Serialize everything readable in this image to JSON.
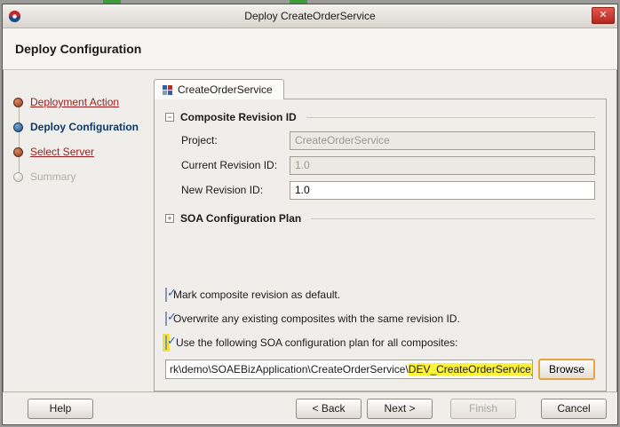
{
  "window": {
    "title": "Deploy CreateOrderService",
    "header": "Deploy Configuration",
    "close_label": "✕"
  },
  "sidebar": {
    "steps": [
      {
        "label": "Deployment Action",
        "state": "link"
      },
      {
        "label": "Deploy Configuration",
        "state": "current"
      },
      {
        "label": "Select Server",
        "state": "link"
      },
      {
        "label": "Summary",
        "state": "disabled"
      }
    ]
  },
  "main": {
    "tab_label": "CreateOrderService",
    "revision_section": {
      "title": "Composite Revision ID",
      "collapse_glyph": "−",
      "fields": [
        {
          "label": "Project:",
          "value": "CreateOrderService",
          "disabled": true
        },
        {
          "label": "Current Revision ID:",
          "value": "1.0",
          "disabled": true
        },
        {
          "label": "New Revision ID:",
          "value": "1.0",
          "disabled": false
        }
      ]
    },
    "configplan_section": {
      "title": "SOA Configuration Plan",
      "expand_glyph": "+"
    },
    "checkboxes": [
      {
        "label": "Mark composite revision as default.",
        "checked": true,
        "tick": "✓"
      },
      {
        "label": "Overwrite any existing composites with the same revision ID.",
        "checked": true,
        "tick": "✓"
      },
      {
        "label": "Use the following SOA configuration plan for all composites:",
        "checked": true,
        "tick": "✓",
        "highlighted": true
      }
    ],
    "path_field": {
      "visible_prefix": "rk\\demo\\SOAEBizApplication\\CreateOrderService\\",
      "highlighted_part": "DEV_CreateOrderService_cfgplan.xml"
    },
    "browse_label": "Browse"
  },
  "footer": {
    "help": "Help",
    "back": "< Back",
    "next": "Next >",
    "finish": "Finish",
    "cancel": "Cancel"
  },
  "colors": {
    "highlight_yellow": "#f3df3d",
    "filename_yellow": "#fef23a",
    "browse_outline_orange": "#e8a33d",
    "link_maroon": "#9b1c1c",
    "current_step_navy": "#0b3a6b",
    "close_red": "#b3271c",
    "check_blue": "#2f5fae"
  }
}
